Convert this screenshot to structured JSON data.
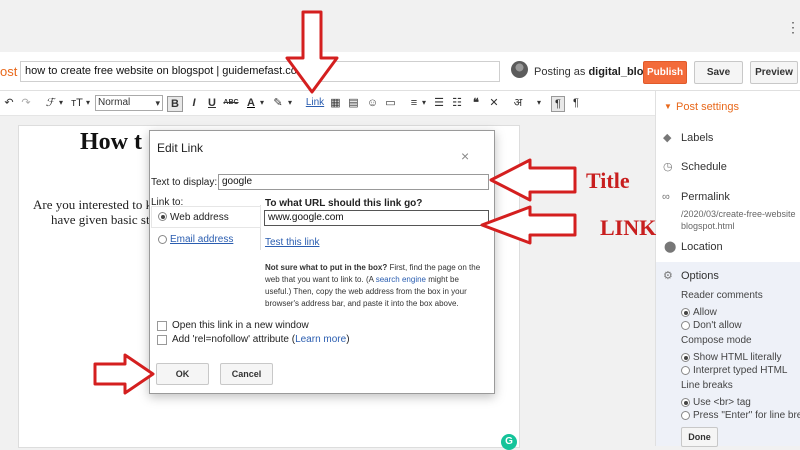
{
  "app": {
    "brand_fragment": "ost"
  },
  "header": {
    "post_title": "how to create free website on blogspot | guidemefast.com",
    "posting_as_prefix": "Posting as",
    "username": "digital_blogger",
    "publish_label": "Publish",
    "save_label": "Save",
    "preview_label": "Preview"
  },
  "toolbar": {
    "font_glyph": "ℱ",
    "size_glyph": "ᴛT",
    "format_value": "Normal",
    "bold_label": "B",
    "italic_label": "I",
    "underline_label": "U",
    "strike_label": "ABC",
    "textcolor_label": "A",
    "link_label": "Link",
    "hindi_glyph": "अ",
    "ltr_label": "¶",
    "rtl_label": "¶"
  },
  "editor": {
    "title_fragment": "How t",
    "para_line1": "Are you interested to k",
    "para_line2": "have given basic ste"
  },
  "dialog": {
    "title": "Edit Link",
    "close_glyph": "×",
    "text_to_display_label": "Text to display:",
    "text_to_display_value": "google",
    "link_to_label": "Link to:",
    "option_web": "Web address",
    "option_email": "Email address",
    "url_heading": "To what URL should this link go?",
    "url_value": "www.google.com",
    "test_link": "Test this link",
    "help_bold": "Not sure what to put in the box?",
    "help_1": " First, find the page on the web that you want to link to. (A ",
    "help_link": "search engine",
    "help_2": " might be useful.) Then, copy the web address from the box in your browser's address bar, and paste it into the box above.",
    "new_window_label": "Open this link in a new window",
    "nofollow_label": "Add 'rel=nofollow' attribute (",
    "learn_more": "Learn more",
    "close_paren": ")",
    "ok_label": "OK",
    "cancel_label": "Cancel"
  },
  "sidebar": {
    "post_settings": "Post settings",
    "labels": "Labels",
    "schedule": "Schedule",
    "permalink": "Permalink",
    "permalink_value_1": "/2020/03/create-free-website",
    "permalink_value_2": "blogspot.html",
    "location": "Location",
    "options": "Options",
    "reader_comments": "Reader comments",
    "allow": "Allow",
    "dont_allow": "Don't allow",
    "compose_mode": "Compose mode",
    "show_html": "Show HTML literally",
    "interpret_html": "Interpret typed HTML",
    "line_breaks": "Line breaks",
    "use_br": "Use <br> tag",
    "press_enter": "Press \"Enter\" for line brea",
    "done_label": "Done"
  },
  "annotations": {
    "title_label": "Title",
    "link_label": "LINK"
  },
  "colors": {
    "publish": "#f36b3a",
    "annotation": "#c81e1e",
    "link": "#2a5db0"
  }
}
